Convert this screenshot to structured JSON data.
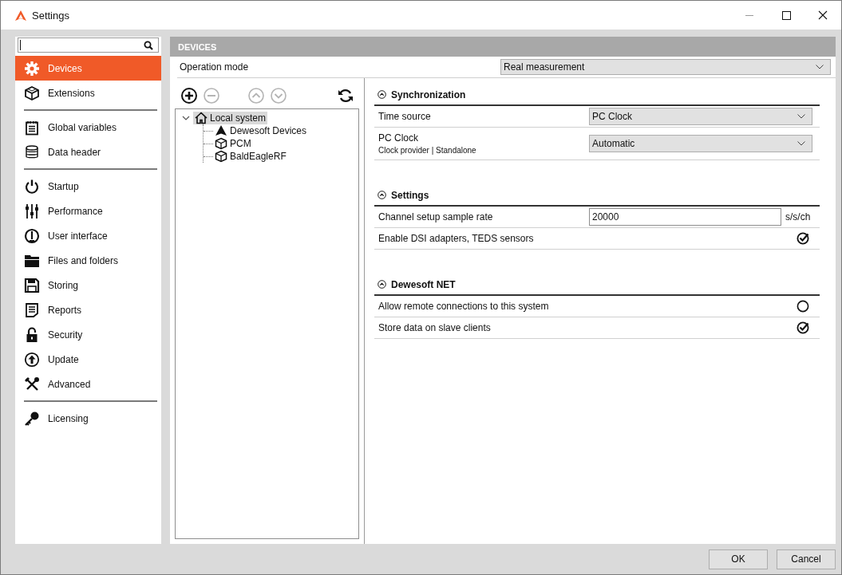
{
  "window": {
    "title": "Settings"
  },
  "sidebar": {
    "groups": [
      {
        "items": [
          {
            "label": "Devices",
            "selected": true
          },
          {
            "label": "Extensions",
            "selected": false
          }
        ]
      },
      {
        "items": [
          {
            "label": "Global variables",
            "selected": false
          },
          {
            "label": "Data header",
            "selected": false
          }
        ]
      },
      {
        "items": [
          {
            "label": "Startup",
            "selected": false
          },
          {
            "label": "Performance",
            "selected": false
          },
          {
            "label": "User interface",
            "selected": false
          },
          {
            "label": "Files and folders",
            "selected": false
          },
          {
            "label": "Storing",
            "selected": false
          },
          {
            "label": "Reports",
            "selected": false
          },
          {
            "label": "Security",
            "selected": false
          },
          {
            "label": "Update",
            "selected": false
          },
          {
            "label": "Advanced",
            "selected": false
          }
        ]
      },
      {
        "items": [
          {
            "label": "Licensing",
            "selected": false
          }
        ]
      }
    ]
  },
  "panel": {
    "header": "DEVICES",
    "operation_mode": {
      "label": "Operation mode",
      "value": "Real measurement"
    }
  },
  "tree_toolbar": [
    {
      "disabled": false
    },
    {
      "disabled": true
    },
    {
      "disabled": true
    },
    {
      "disabled": true
    },
    {
      "disabled": false
    }
  ],
  "tree": [
    {
      "label": "Local system",
      "selected": true,
      "expanded": true,
      "children": [
        {
          "label": "Dewesoft Devices",
          "selected": false
        },
        {
          "label": "PCM",
          "selected": false
        },
        {
          "label": "BaldEagleRF",
          "selected": false
        }
      ]
    }
  ],
  "sections": [
    {
      "title": "Synchronization",
      "expanded": true,
      "rows": [
        {
          "kind": "select",
          "label": "Time source",
          "value": "PC Clock"
        },
        {
          "kind": "select",
          "label": "PC Clock",
          "sublabel": "Clock provider | Standalone",
          "value": "Automatic"
        }
      ]
    },
    {
      "title": "Settings",
      "expanded": true,
      "rows": [
        {
          "kind": "input",
          "label": "Channel setup sample rate",
          "value": "20000",
          "unit": "s/s/ch"
        },
        {
          "kind": "check",
          "label": "Enable DSI adapters, TEDS sensors",
          "checked": true
        }
      ]
    },
    {
      "title": "Dewesoft NET",
      "expanded": true,
      "rows": [
        {
          "kind": "check",
          "label": "Allow remote connections to this system",
          "checked": false
        },
        {
          "kind": "check",
          "label": "Store data on slave clients",
          "checked": true
        }
      ]
    }
  ],
  "buttons": [
    "OK",
    "Cancel"
  ]
}
